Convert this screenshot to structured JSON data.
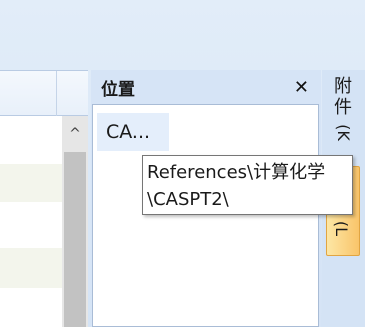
{
  "panel": {
    "title": "位置",
    "close_glyph": "✕",
    "items": [
      {
        "label": "CA..."
      }
    ]
  },
  "tooltip": {
    "line1": "References\\计算化学",
    "line2": "\\CASPT2\\"
  },
  "side_tabs": {
    "tab1_text_top": "附",
    "tab1_text_mid": "件",
    "tab1_glyph": "(K",
    "tab2_glyph": "(L"
  },
  "scrollbar": {
    "up_glyph": "^"
  },
  "colors": {
    "panel_bg": "#d6e4f6",
    "selection": "#e4eefb",
    "active_tab": "#f9c46a",
    "scroll_thumb": "#c2c2c2"
  }
}
